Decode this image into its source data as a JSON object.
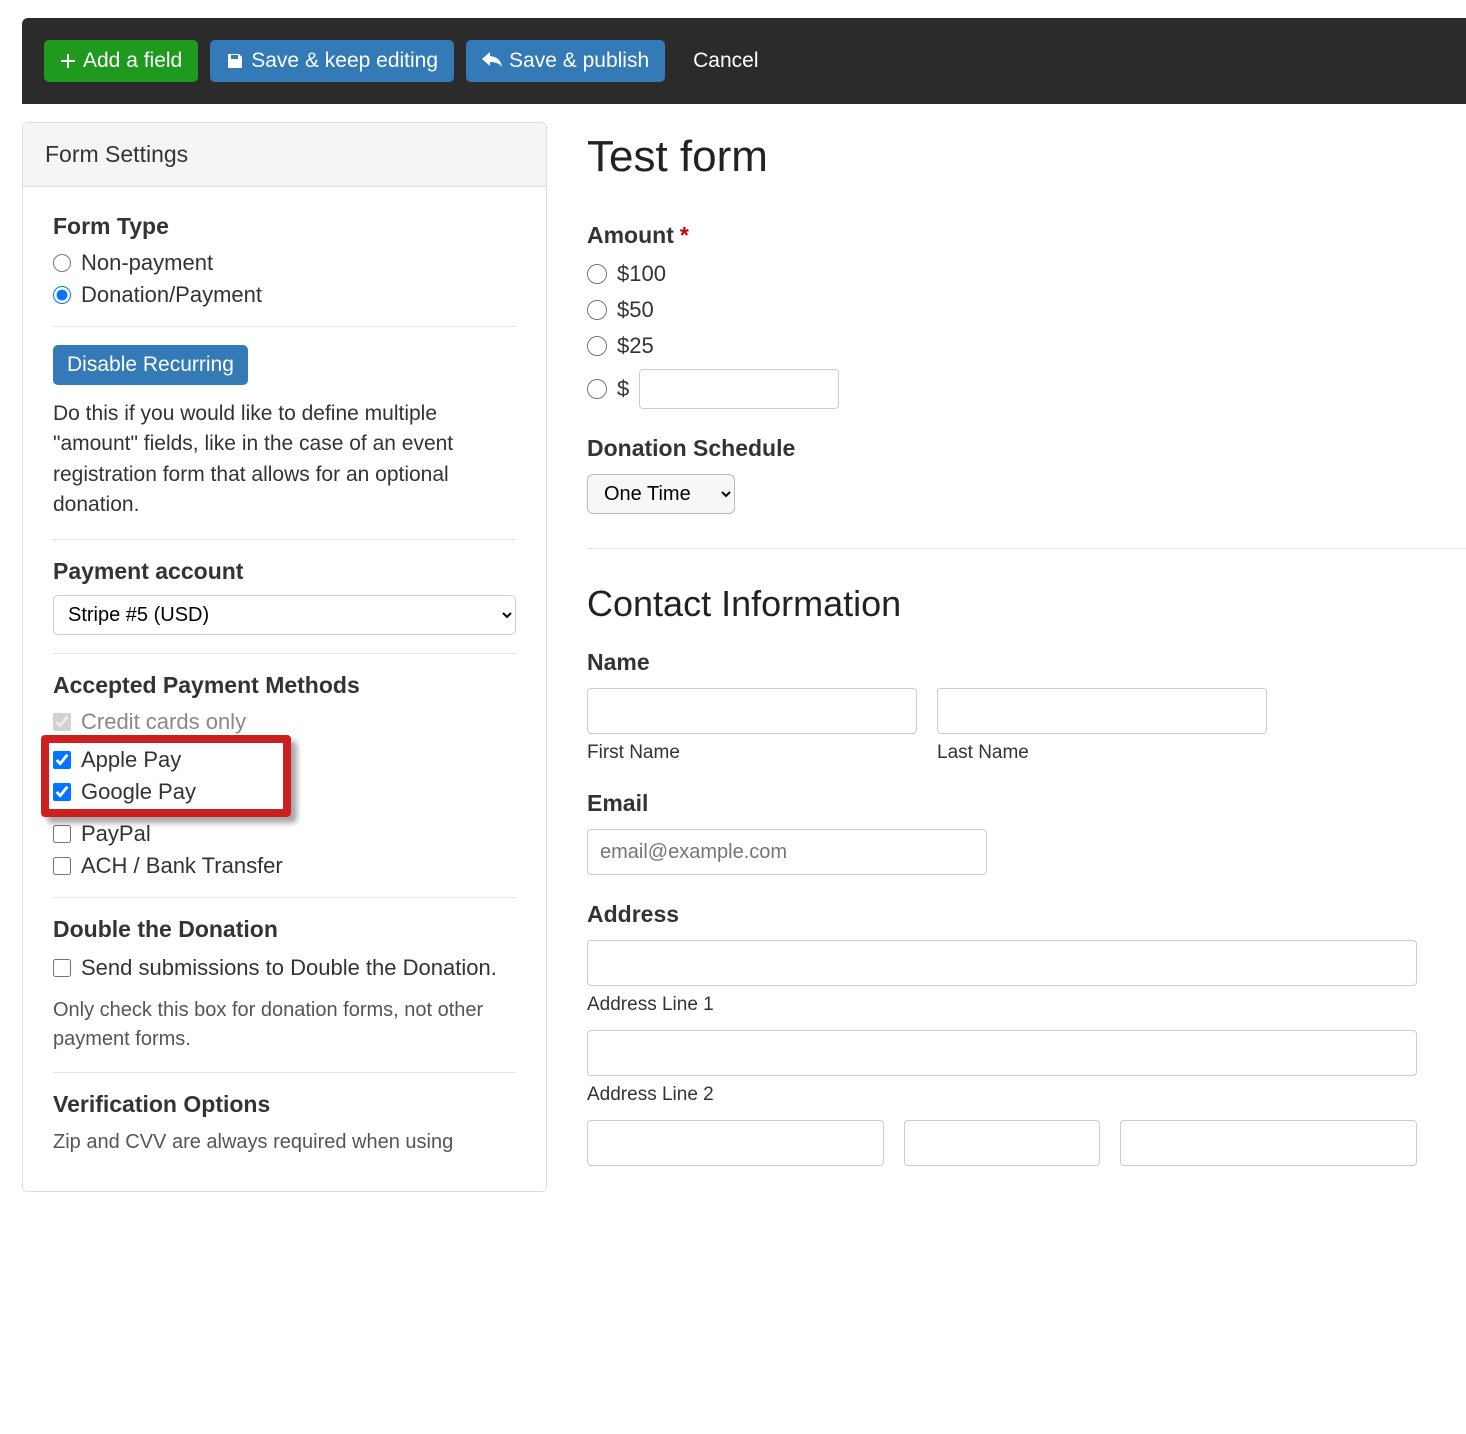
{
  "toolbar": {
    "add_field": "Add a field",
    "save_keep": "Save & keep editing",
    "save_publish": "Save & publish",
    "cancel": "Cancel"
  },
  "sidebar": {
    "header": "Form Settings",
    "form_type": {
      "label": "Form Type",
      "options": [
        "Non-payment",
        "Donation/Payment"
      ],
      "selected": "Donation/Payment"
    },
    "disable_recurring": {
      "button": "Disable Recurring",
      "help": "Do this if you would like to define multiple \"amount\" fields, like in the case of an event registration form that allows for an optional donation."
    },
    "payment_account": {
      "label": "Payment account",
      "selected": "Stripe #5 (USD)"
    },
    "accepted": {
      "label": "Accepted Payment Methods",
      "methods": [
        {
          "label": "Credit cards only",
          "checked": true,
          "disabled": true
        },
        {
          "label": "Apple Pay",
          "checked": true,
          "disabled": false
        },
        {
          "label": "Google Pay",
          "checked": true,
          "disabled": false
        },
        {
          "label": "PayPal",
          "checked": false,
          "disabled": false
        },
        {
          "label": "ACH / Bank Transfer",
          "checked": false,
          "disabled": false
        }
      ]
    },
    "double": {
      "label": "Double the Donation",
      "checkbox_label": "Send submissions to Double the Donation.",
      "help": "Only check this box for donation forms, not other payment forms."
    },
    "verify": {
      "label": "Verification Options",
      "help": "Zip and CVV are always required when using"
    }
  },
  "form": {
    "title": "Test form",
    "amount": {
      "label": "Amount",
      "options": [
        "$100",
        "$50",
        "$25"
      ],
      "custom_prefix": "$"
    },
    "schedule": {
      "label": "Donation Schedule",
      "selected": "One Time"
    },
    "contact_heading": "Contact Information",
    "name": {
      "label": "Name",
      "first_sub": "First Name",
      "last_sub": "Last Name"
    },
    "email": {
      "label": "Email",
      "placeholder": "email@example.com"
    },
    "address": {
      "label": "Address",
      "line1_sub": "Address Line 1",
      "line2_sub": "Address Line 2"
    }
  }
}
